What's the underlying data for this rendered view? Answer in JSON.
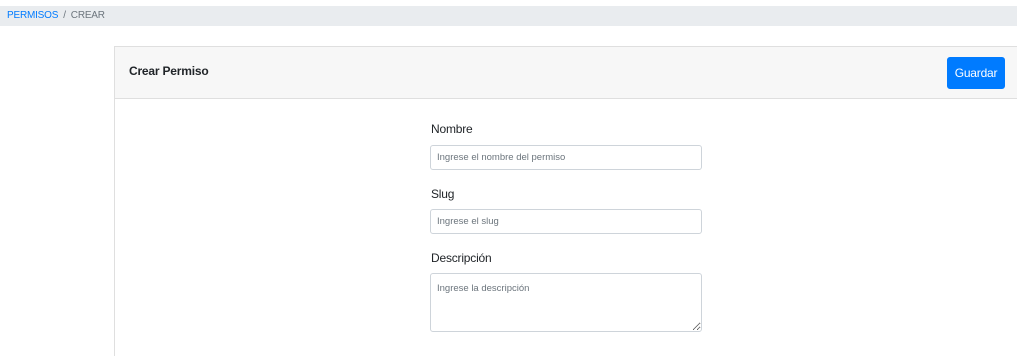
{
  "breadcrumb": {
    "items": [
      {
        "label": "PERMISOS"
      },
      {
        "label": "CREAR"
      }
    ],
    "separator": "/"
  },
  "card": {
    "title": "Crear Permiso",
    "save_label": "Guardar"
  },
  "form": {
    "nombre": {
      "label": "Nombre",
      "placeholder": "Ingrese el nombre del permiso",
      "value": ""
    },
    "slug": {
      "label": "Slug",
      "placeholder": "Ingrese el slug",
      "value": ""
    },
    "descripcion": {
      "label": "Descripción",
      "placeholder": "Ingrese la descripción",
      "value": ""
    }
  },
  "colors": {
    "primary": "#007bff",
    "breadcrumb_bg": "#e9ecef",
    "card_header_bg": "#f7f7f7",
    "border": "#ced4da"
  }
}
